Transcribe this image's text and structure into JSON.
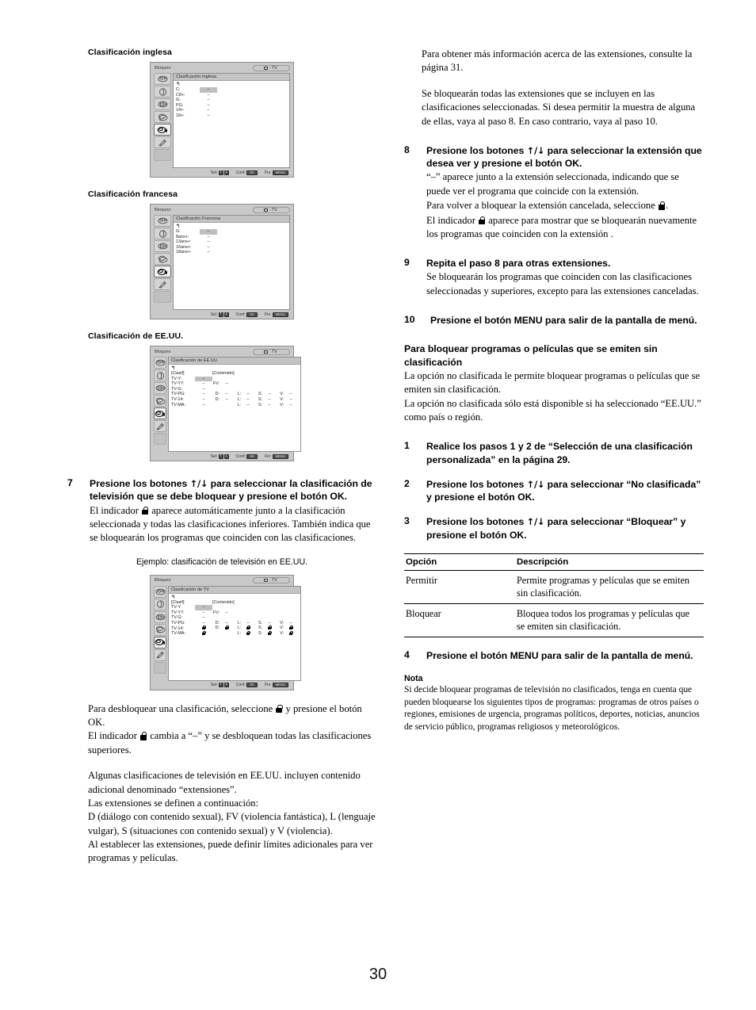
{
  "page": {
    "number": "30"
  },
  "left_column": {
    "sections": [
      {
        "heading": "Clasificación inglesa"
      },
      {
        "heading": "Clasificación francesa"
      },
      {
        "heading": "Clasificación de EE.UU."
      }
    ],
    "caption_example": "Ejemplo: clasificación de televisión en EE.UU.",
    "step7": {
      "number": "7",
      "title_a": "Presione los botones ",
      "title_arrows": "↑/↓",
      "title_b": " para seleccionar la clasificación de televisión que se debe bloquear y presione el botón OK.",
      "body_a": "El indicador ",
      "body_b": " aparece automáticamente junto a la clasificación seleccionada y todas las clasificaciones inferiores. También indica que se bloquearán los programas que coinciden con las clasificaciones."
    },
    "after_p1_a": "Para desbloquear una clasificación, seleccione ",
    "after_p1_b": " y presione el botón OK.",
    "after_p2_a": "El indicador ",
    "after_p2_b": " cambia a “–” y se desbloquean todas las clasificaciones superiores.",
    "after_p3": "Algunas clasificaciones de televisión en EE.UU. incluyen contenido adicional denominado “extensiones”.",
    "after_p4": "Las extensiones se definen a continuación:",
    "after_p5": "D (diálogo con contenido sexual), FV (violencia fantástica), L (lenguaje vulgar), S (situaciones con contenido sexual) y V (violencia).",
    "after_p6": "Al establecer las extensiones, puede definir límites adicionales para ver programas y películas."
  },
  "right_column": {
    "p_intro1": "Para obtener más información acerca de las extensiones, consulte la página 31.",
    "p_intro2": "Se bloquearán todas las extensiones que se incluyen en las clasificaciones seleccionadas. Si desea permitir la muestra de alguna de ellas, vaya al paso 8. En caso contrario, vaya al paso 10.",
    "step8": {
      "number": "8",
      "title_a": "Presione los botones ",
      "title_arrows": "↑/↓",
      "title_b": " para seleccionar la extensión que desea ver y presione el botón OK.",
      "body_l1": "“–” aparece junto a la extensión seleccionada, indicando que se puede ver el programa que coincide con la extensión.",
      "body_l2_a": "Para volver a bloquear la extensión cancelada, seleccione ",
      "body_l2_b": ".",
      "body_l3_a": "El indicador ",
      "body_l3_b": " aparece para mostrar que se bloquearán nuevamente los programas que coinciden con la extensión ."
    },
    "step9": {
      "number": "9",
      "title": "Repita el paso 8 para otras extensiones.",
      "body": "Se bloquearán los programas que coinciden con las clasificaciones seleccionadas y superiores, excepto para las extensiones canceladas."
    },
    "step10": {
      "number": "10",
      "title": "Presione el botón MENU para salir de la pantalla de menú."
    },
    "unrated_heading": "Para bloquear programas o películas que se emiten sin clasificación",
    "unrated_p1": "La opción no clasificada le permite bloquear programas o películas que se emiten sin clasificación.",
    "unrated_p2": "La opción no clasificada sólo está disponible si ha seleccionado “EE.UU.” como país o región.",
    "step_u1": {
      "number": "1",
      "title": "Realice los pasos 1 y 2 de “Selección de una clasificación personalizada” en la página 29."
    },
    "step_u2": {
      "number": "2",
      "title_a": "Presione los botones ",
      "title_arrows": "↑/↓",
      "title_b": " para seleccionar “No clasificada” y presione el botón OK."
    },
    "step_u3": {
      "number": "3",
      "title_a": "Presione los botones ",
      "title_arrows": "↑/↓",
      "title_b": " para seleccionar “Bloquear” y presione el botón OK."
    },
    "option_table": {
      "headers": [
        "Opción",
        "Descripción"
      ],
      "rows": [
        [
          "Permitir",
          "Permite programas y películas que se emiten sin clasificación."
        ],
        [
          "Bloquear",
          "Bloquea todos los programas y películas que se emiten sin clasificación."
        ]
      ]
    },
    "step_u4": {
      "number": "4",
      "title": "Presione el botón MENU para salir de la pantalla de menú."
    },
    "note": {
      "heading": "Nota",
      "body": "Si decide bloquear programas de televisión no clasificados, tenga en cuenta que pueden bloquearse los siguientes tipos de programas: programas de otros países o regiones, emisiones de urgencia, programas políticos, deportes, noticias, anuncios de servicio público, programas religiosos y meteorológicos."
    }
  },
  "osd": {
    "window_title": "Bloqueo",
    "source_label": ": TV",
    "footer": {
      "sel_label": "Sel:",
      "sel_key_up": "↑",
      "sel_key_down": "↓",
      "conf_label": "Conf:",
      "conf_key": "OK",
      "fin_label": "Fin:",
      "fin_key": "MENU"
    },
    "screens": [
      {
        "panel_title": "Clasificación Inglesa",
        "columns": [],
        "rows": [
          {
            "label": "C:",
            "value": "–",
            "highlight": true,
            "ext": []
          },
          {
            "label": "C8+:",
            "value": "–",
            "highlight": false,
            "ext": []
          },
          {
            "label": "G:",
            "value": "–",
            "highlight": false,
            "ext": []
          },
          {
            "label": "PG:",
            "value": "–",
            "highlight": false,
            "ext": []
          },
          {
            "label": "14+:",
            "value": "–",
            "highlight": false,
            "ext": []
          },
          {
            "label": "18+:",
            "value": "–",
            "highlight": false,
            "ext": []
          }
        ]
      },
      {
        "panel_title": "Clasificación Francesa",
        "columns": [],
        "rows": [
          {
            "label": "G:",
            "value": "–",
            "highlight": true,
            "ext": []
          },
          {
            "label": "8ans+:",
            "value": "–",
            "highlight": false,
            "ext": []
          },
          {
            "label": "13ans+:",
            "value": "–",
            "highlight": false,
            "ext": []
          },
          {
            "label": "16ans+:",
            "value": "–",
            "highlight": false,
            "ext": []
          },
          {
            "label": "18ans+:",
            "value": "–",
            "highlight": false,
            "ext": []
          }
        ]
      },
      {
        "panel_title": "Clasificación de EE.UU.",
        "columns": [
          "[Clasif]",
          "[Contenido]"
        ],
        "rows": [
          {
            "label": "TV-Y:",
            "value": "–",
            "highlight": true,
            "ext": []
          },
          {
            "label": "TV-Y7:",
            "value": "–",
            "highlight": false,
            "ext": [
              {
                "k": "FV:",
                "v": "–"
              }
            ]
          },
          {
            "label": "TV-G:",
            "value": "–",
            "highlight": false,
            "ext": []
          },
          {
            "label": "TV-PG:",
            "value": "–",
            "highlight": false,
            "ext": [
              {
                "k": "D:",
                "v": "–"
              },
              {
                "k": "L:",
                "v": "–"
              },
              {
                "k": "S:",
                "v": "–"
              },
              {
                "k": "V:",
                "v": "–"
              }
            ]
          },
          {
            "label": "TV-14:",
            "value": "–",
            "highlight": false,
            "ext": [
              {
                "k": "D:",
                "v": "–"
              },
              {
                "k": "L:",
                "v": "–"
              },
              {
                "k": "S:",
                "v": "–"
              },
              {
                "k": "V:",
                "v": "–"
              }
            ]
          },
          {
            "label": "TV-MA:",
            "value": "–",
            "highlight": false,
            "ext": [
              {
                "k": "",
                "v": ""
              },
              {
                "k": "L:",
                "v": "–"
              },
              {
                "k": "S:",
                "v": "–"
              },
              {
                "k": "V:",
                "v": "–"
              }
            ]
          }
        ]
      },
      {
        "panel_title": "Clasificación de TV",
        "columns": [
          "[Clasif]",
          "[Contenido]"
        ],
        "rows": [
          {
            "label": "TV-Y:",
            "value": "–",
            "highlight": true,
            "ext": []
          },
          {
            "label": "TV-Y7:",
            "value": "–",
            "highlight": false,
            "ext": [
              {
                "k": "FV:",
                "v": "–"
              }
            ]
          },
          {
            "label": "TV-G:",
            "value": "–",
            "highlight": false,
            "ext": []
          },
          {
            "label": "TV-PG:",
            "value": "–",
            "highlight": false,
            "ext": [
              {
                "k": "D:",
                "v": "–"
              },
              {
                "k": "L:",
                "v": "–"
              },
              {
                "k": "S:",
                "v": "–"
              },
              {
                "k": "V:",
                "v": "–"
              }
            ]
          },
          {
            "label": "TV-14:",
            "value": "LOCK",
            "highlight": false,
            "ext": [
              {
                "k": "D:",
                "v": "LOCK"
              },
              {
                "k": "L:",
                "v": "LOCK"
              },
              {
                "k": "S:",
                "v": "LOCK"
              },
              {
                "k": "V:",
                "v": "LOCK"
              }
            ]
          },
          {
            "label": "TV-MA:",
            "value": "LOCK",
            "highlight": false,
            "ext": [
              {
                "k": "",
                "v": ""
              },
              {
                "k": "L:",
                "v": "LOCK"
              },
              {
                "k": "S:",
                "v": "LOCK"
              },
              {
                "k": "V:",
                "v": "LOCK"
              }
            ]
          }
        ]
      }
    ],
    "rail_icons": [
      "picture-settings-icon",
      "audio-settings-icon",
      "screen-settings-icon",
      "channel-settings-icon",
      "parental-lock-icon",
      "setup-settings-icon"
    ]
  }
}
